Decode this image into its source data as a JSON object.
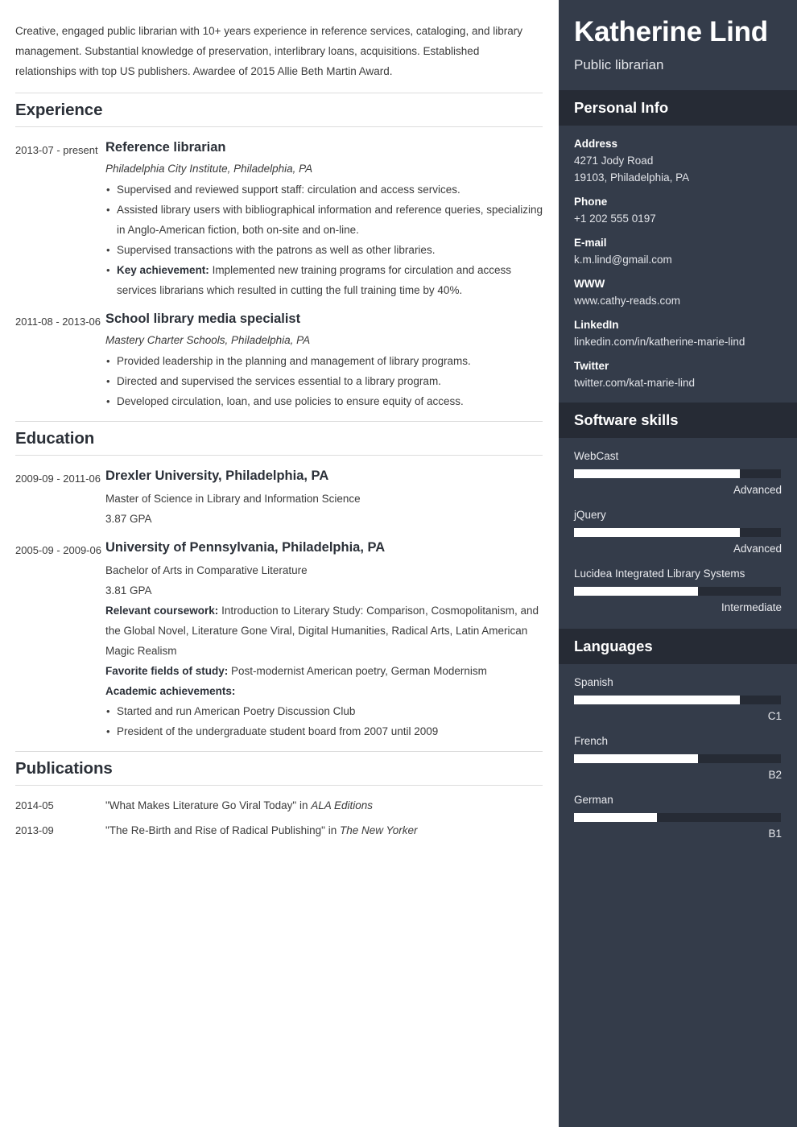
{
  "theme": {
    "sidebar_bg": "#343c4a",
    "sidebar_band_bg": "#262b35",
    "bar_fill": "#ffffff",
    "heading_color": "#2b3038"
  },
  "main": {
    "summary": "Creative, engaged public librarian with 10+ years experience in reference services, cataloging, and library management. Substantial knowledge of preservation, interlibrary loans, acquisitions. Established relationships with top US publishers. Awardee of 2015 Allie Beth Martin Award.",
    "experience": {
      "heading": "Experience",
      "entries": [
        {
          "date": "2013-07 - present",
          "title": "Reference librarian",
          "subtitle": "Philadelphia City Institute, Philadelphia, PA",
          "bullets": [
            {
              "lead": "",
              "text": "Supervised and reviewed support staff: circulation and access services."
            },
            {
              "lead": "",
              "text": "Assisted library users with bibliographical information and reference queries, specializing in Anglo-American fiction, both on-site and on-line."
            },
            {
              "lead": "",
              "text": "Supervised transactions with the patrons as well as other libraries."
            },
            {
              "lead": "Key achievement:",
              "text": "Implemented new training programs for circulation and access services librarians which resulted in cutting the full training time by 40%."
            }
          ]
        },
        {
          "date": "2011-08 - 2013-06",
          "title": "School library media specialist",
          "subtitle": "Mastery Charter Schools, Philadelphia, PA",
          "bullets": [
            {
              "lead": "",
              "text": "Provided leadership in the planning and management of library programs."
            },
            {
              "lead": "",
              "text": "Directed and supervised the services essential to a library program."
            },
            {
              "lead": "",
              "text": "Developed circulation, loan, and use policies to ensure equity of access."
            }
          ]
        }
      ]
    },
    "education": {
      "heading": "Education",
      "entries": [
        {
          "date": "2009-09 - 2011-06",
          "title": "Drexler University, Philadelphia, PA",
          "degree": "Master of Science in Library and Information Science",
          "gpa": "3.87 GPA"
        },
        {
          "date": "2005-09 - 2009-06",
          "title": "University of Pennsylvania, Philadelphia, PA",
          "degree": "Bachelor of Arts in Comparative Literature",
          "gpa": "3.81 GPA",
          "coursework_label": "Relevant coursework:",
          "coursework": "Introduction to Literary Study: Comparison, Cosmopolitanism, and the Global Novel, Literature Gone Viral, Digital Humanities, Radical Arts, Latin American Magic Realism",
          "favorite_label": "Favorite fields of study:",
          "favorite": "Post-modernist American poetry, German Modernism",
          "achievements_label": "Academic achievements:",
          "achievements": [
            "Started and run American Poetry Discussion Club",
            "President of the undergraduate student board from 2007 until 2009"
          ]
        }
      ]
    },
    "publications": {
      "heading": "Publications",
      "entries": [
        {
          "date": "2014-05",
          "title": "\"What Makes Literature Go Viral Today\" in ",
          "venue": "ALA Editions"
        },
        {
          "date": "2013-09",
          "title": "\"The Re-Birth and Rise of Radical Publishing\" in ",
          "venue": "The New Yorker"
        }
      ]
    }
  },
  "sidebar": {
    "name": "Katherine Lind",
    "role": "Public librarian",
    "personal_info": {
      "heading": "Personal Info",
      "fields": [
        {
          "label": "Address",
          "values": [
            "4271 Jody Road",
            "19103, Philadelphia, PA"
          ]
        },
        {
          "label": "Phone",
          "values": [
            "+1 202 555 0197"
          ]
        },
        {
          "label": "E-mail",
          "values": [
            "k.m.lind@gmail.com"
          ]
        },
        {
          "label": "WWW",
          "values": [
            "www.cathy-reads.com"
          ]
        },
        {
          "label": "LinkedIn",
          "values": [
            "linkedin.com/in/katherine-marie-lind"
          ]
        },
        {
          "label": "Twitter",
          "values": [
            "twitter.com/kat-marie-lind"
          ]
        }
      ]
    },
    "software_skills": {
      "heading": "Software skills",
      "items": [
        {
          "name": "WebCast",
          "level": "Advanced",
          "percent": 80
        },
        {
          "name": "jQuery",
          "level": "Advanced",
          "percent": 80
        },
        {
          "name": "Lucidea Integrated Library Systems",
          "level": "Intermediate",
          "percent": 60
        }
      ]
    },
    "languages": {
      "heading": "Languages",
      "items": [
        {
          "name": "Spanish",
          "level": "C1",
          "percent": 80
        },
        {
          "name": "French",
          "level": "B2",
          "percent": 60
        },
        {
          "name": "German",
          "level": "B1",
          "percent": 40
        }
      ]
    }
  }
}
